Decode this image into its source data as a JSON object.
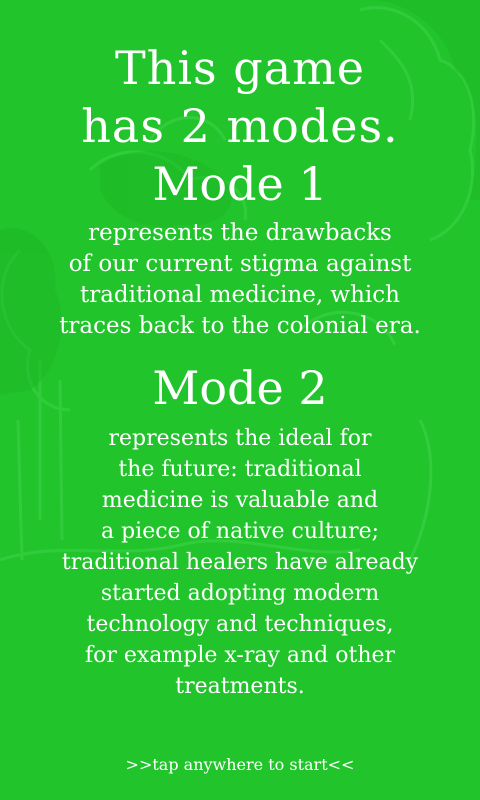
{
  "title": [
    "This game",
    "has 2 modes."
  ],
  "mode1": {
    "heading": "Mode 1",
    "lines": [
      "represents the drawbacks",
      "of our current stigma against",
      "traditional medicine, which",
      "traces back to the colonial era."
    ]
  },
  "mode2": {
    "heading": "Mode 2",
    "lines": [
      "represents the ideal for",
      "the future: traditional",
      "medicine is valuable and",
      "a piece of native culture;",
      "traditional healers have already",
      "started adopting modern",
      "technology and techniques,",
      "for example x-ray and other",
      "treatments."
    ]
  },
  "start_prompt": ">>tap anywhere to start<<",
  "colors": {
    "background": "#22c42c",
    "text": "#ffffff"
  }
}
